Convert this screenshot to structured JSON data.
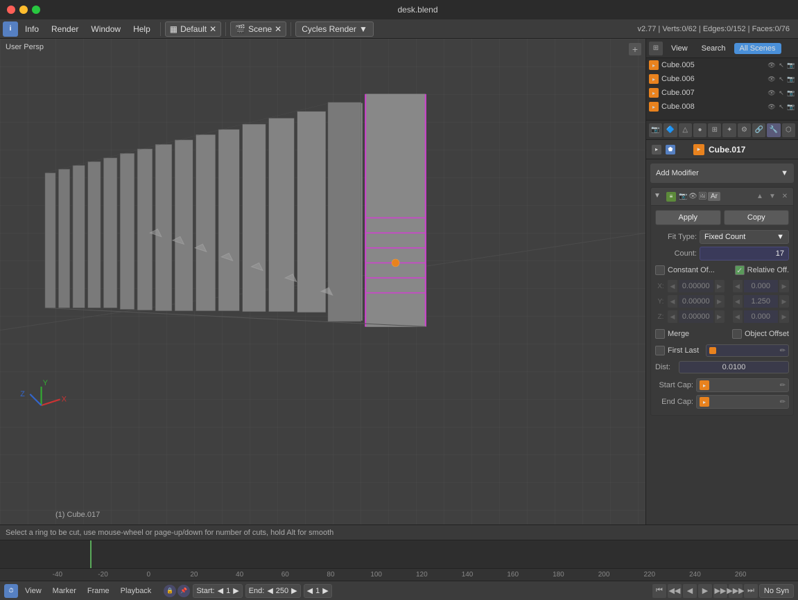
{
  "window": {
    "title": "desk.blend",
    "buttons": {
      "close": "●",
      "min": "●",
      "max": "●"
    }
  },
  "menubar": {
    "icon": "i",
    "items": [
      "Info",
      "Render",
      "Window",
      "Help"
    ],
    "workspace": "Default",
    "scene": "Scene",
    "engine": "Cycles Render",
    "stats": "v2.77  |  Verts:0/62  |  Edges:0/152  |  Faces:0/76"
  },
  "viewport": {
    "label": "User Persp",
    "add_btn": "+"
  },
  "outliner": {
    "tabs": {
      "view": "View",
      "search": "Search",
      "all_scenes": "All Scenes"
    },
    "items": [
      {
        "name": "Cube.005",
        "visible": true
      },
      {
        "name": "Cube.006",
        "visible": true
      },
      {
        "name": "Cube.007",
        "visible": true
      },
      {
        "name": "Cube.008",
        "visible": true
      }
    ]
  },
  "properties": {
    "toolbar_icons": [
      "camera",
      "obj",
      "mesh",
      "mat",
      "tex",
      "part",
      "phys",
      "constr",
      "mod",
      "data"
    ],
    "object_name": "Cube.017",
    "add_modifier_label": "Add Modifier",
    "modifier": {
      "name": "Ar",
      "apply_label": "Apply",
      "copy_label": "Copy",
      "fit_type_label": "Fit Type:",
      "fit_type_value": "Fixed Count",
      "count_label": "Count:",
      "count_value": "17",
      "constant_offset_label": "Constant Of...",
      "relative_offset_label": "Relative Off.",
      "constant_offset_checked": false,
      "relative_offset_checked": true,
      "offset_x": "0.000",
      "offset_y": "1.250",
      "offset_z": "0.000",
      "const_x": "0.00000",
      "const_y": "0.00000",
      "const_z": "0.00000",
      "merge_label": "Merge",
      "merge_checked": false,
      "object_offset_label": "Object Offset",
      "object_offset_checked": false,
      "first_last_label": "First Last",
      "first_last_checked": false,
      "dist_label": "Dist:",
      "dist_value": "0.0100",
      "start_cap_label": "Start Cap:",
      "end_cap_label": "End Cap:"
    }
  },
  "timeline": {
    "start_label": "Start:",
    "start_value": "1",
    "end_label": "End:",
    "end_value": "250",
    "frame_value": "1",
    "sync_label": "No Syn",
    "frame_numbers": [
      "-40",
      "-20",
      "0",
      "20",
      "40",
      "60",
      "80",
      "100",
      "120",
      "140",
      "160",
      "180",
      "200",
      "220",
      "240",
      "260"
    ],
    "menu_items": [
      "View",
      "Marker",
      "Frame",
      "Playback"
    ]
  },
  "status_bar": {
    "text": "Select a ring to be cut, use mouse-wheel or page-up/down for number of cuts, hold Alt for smooth"
  },
  "object_label": "(1) Cube.017"
}
